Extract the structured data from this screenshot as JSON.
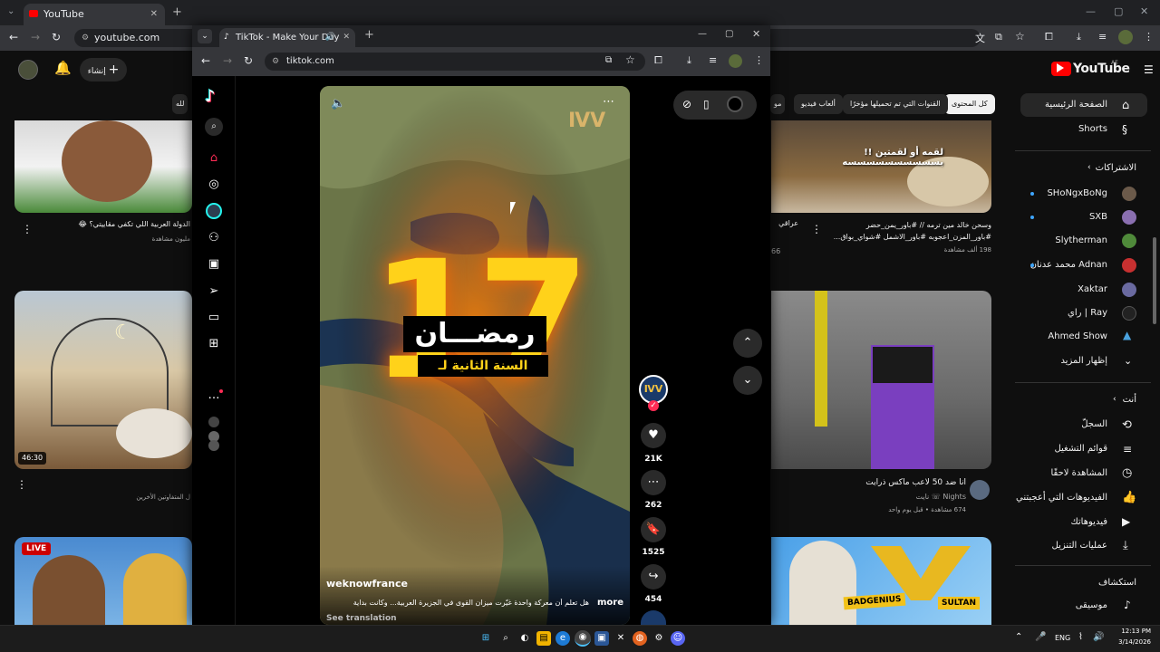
{
  "background_browser": {
    "tab_title": "YouTube",
    "url": "youtube.com"
  },
  "youtube": {
    "create_label": "إنشاء",
    "logo_text": "YouTube",
    "logo_region": "AE",
    "chips": [
      "كل المحتوى",
      "القنوات التي تم تحميلها مؤخرًا",
      "ألعاب فيديو",
      "مو",
      "لله"
    ],
    "nav": [
      {
        "label": "الصفحة الرئيسية"
      },
      {
        "label": "Shorts"
      }
    ],
    "subscriptions_header": "الاشتراكات",
    "subscriptions": [
      {
        "label": "SHoNgxBoNg"
      },
      {
        "label": "SXB"
      },
      {
        "label": "Slytherman"
      },
      {
        "label": "محمد عدنان Adnan"
      },
      {
        "label": "Xaktar"
      },
      {
        "label": "راي | Ray"
      },
      {
        "label": "Ahmed Show"
      },
      {
        "label": "إظهار المزيد"
      }
    ],
    "you_header": "أنت",
    "you_items": [
      {
        "label": "السجلّ"
      },
      {
        "label": "قوائم التشغيل"
      },
      {
        "label": "المشاهدة لاحقًا"
      },
      {
        "label": "الفيديوهات التي أعجبتني"
      },
      {
        "label": "فيديوهاتك"
      },
      {
        "label": "عمليات التنزيل"
      }
    ],
    "explore_header": "استكشاف",
    "explore_items": [
      {
        "label": "موسيقى"
      }
    ],
    "videos": {
      "top_left_title": "الدولة العربية اللي تكفي مقاييتي؟ 😂",
      "top_left_meta": "مليون مشاهدة",
      "top_mid_title": "عراقي",
      "top_mid_meta": "66",
      "top_right_title": "وسحن خالد مين ترمه // #باور_يمن_حضر #باور_المزن_اعجوبه #باور_الاشمل #شواي_بواق...",
      "top_right_meta": "198 ألف مشاهدة",
      "top_right_overlay": "لقمه أو لقمتين !! بسسسسسسسسسسه",
      "mid_left_duration": "46:30",
      "mid_left_meta": "ل المتفاوتين الأخرين",
      "mid_right_title": "انا ضد 50 لاعب ماكس ذرايت",
      "mid_right_channel": "Nights ☏ نايت",
      "mid_right_meta": "674 مشاهدة • قبل يوم واحد",
      "bottom_left_badge": "LIVE",
      "bottom_right_label_1": "BADGENIUS",
      "bottom_right_label_2": "SULTAN"
    }
  },
  "tiktok_window": {
    "tab_title": "TikTok - Make Your Day",
    "url": "tiktok.com",
    "video": {
      "overlay_title": "رمضـــان",
      "overlay_subtitle": "السنة الثانية لـ",
      "overlay_number": "17",
      "author": "weknowfrance",
      "caption": "هل تعلم أن معركة واحدة غيّرت ميزان القوى في الجزيرة العربية... وكانت بداية",
      "more_label": "more",
      "translate_label": "See translation"
    },
    "actions": {
      "likes": "21K",
      "comments": "262",
      "saves": "1525",
      "shares": "454"
    }
  },
  "taskbar": {
    "lang": "ENG",
    "time": "12:13 PM",
    "date": "3/14/2026"
  },
  "colors": {
    "yt_red": "#ff0000",
    "tiktok_pink": "#fe2c55",
    "overlay_yellow": "#ffd21a"
  }
}
